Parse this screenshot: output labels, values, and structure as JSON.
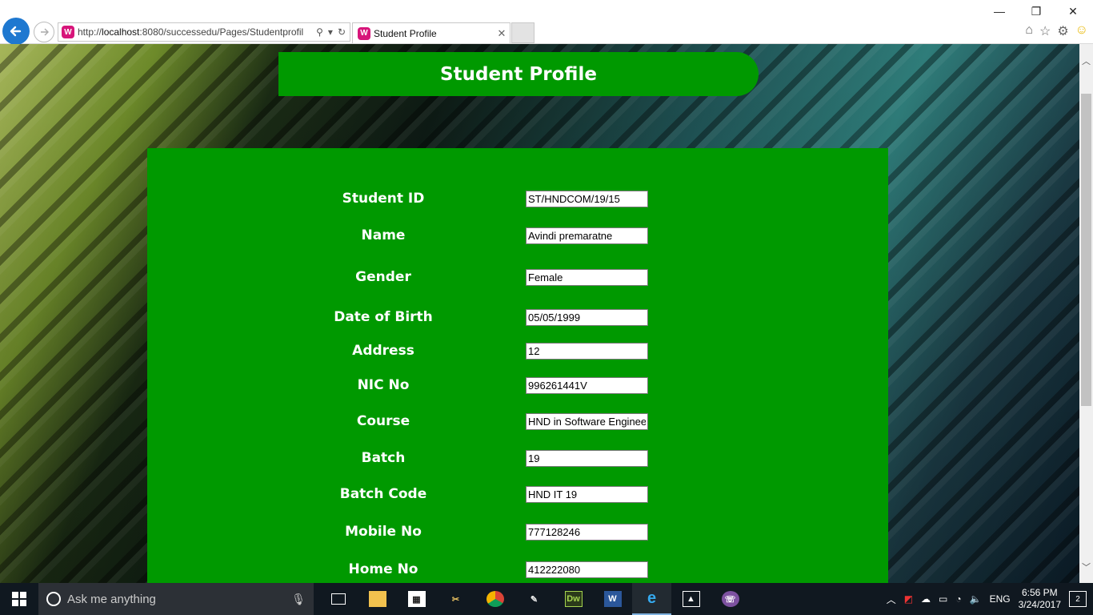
{
  "browser": {
    "url_prefix": "http://",
    "url_host": "localhost",
    "url_rest": ":8080/successedu/Pages/Studentprofil",
    "tab_title": "Student Profile",
    "site_icon_letter": "W",
    "window_controls": {
      "minimize": "—",
      "restore": "❐",
      "close": "✕"
    }
  },
  "page": {
    "title": "Student Profile",
    "fields": [
      {
        "label": "Student ID",
        "value": "ST/HNDCOM/19/15"
      },
      {
        "label": "Name",
        "value": "Avindi premaratne"
      },
      {
        "label": "Gender",
        "value": "Female"
      },
      {
        "label": "Date of Birth",
        "value": "05/05/1999"
      },
      {
        "label": "Address",
        "value": "12"
      },
      {
        "label": "NIC No",
        "value": "996261441V"
      },
      {
        "label": "Course",
        "value": "HND in Software Engineering"
      },
      {
        "label": "Batch",
        "value": "19"
      },
      {
        "label": "Batch Code",
        "value": "HND IT 19"
      },
      {
        "label": "Mobile No",
        "value": "777128246"
      },
      {
        "label": "Home No",
        "value": "412222080"
      }
    ]
  },
  "taskbar": {
    "search_placeholder": "Ask me anything",
    "language": "ENG",
    "time": "6:56 PM",
    "date": "3/24/2017",
    "notifications": "2",
    "app_icons": [
      "task-view-icon",
      "file-explorer-icon",
      "store-icon",
      "tools-icon",
      "chrome-icon",
      "paint-icon",
      "dreamweaver-icon",
      "word-icon",
      "internet-explorer-icon",
      "photos-icon",
      "viber-icon"
    ]
  },
  "colors": {
    "panel_green": "#009900",
    "taskbar": "#101820",
    "browser_back": "#1e78d0"
  }
}
